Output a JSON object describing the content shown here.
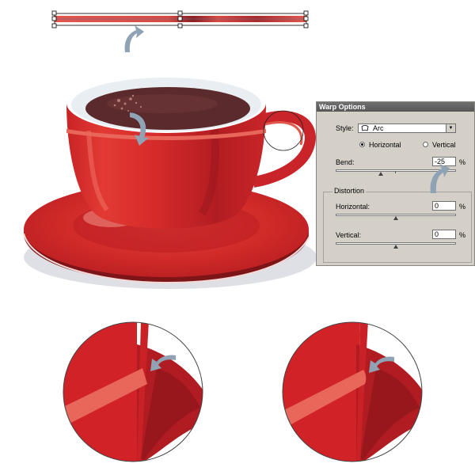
{
  "dialog": {
    "title": "Warp Options",
    "style_label": "Style:",
    "style_value": "Arc",
    "orientation": {
      "horizontal_label": "Horizontal",
      "vertical_label": "Vertical",
      "selected": "horizontal"
    },
    "bend_label": "Bend:",
    "bend_value": "-25",
    "bend_unit": "%",
    "bend_level": 0.375,
    "distortion_label": "Distortion",
    "horizontal_label": "Horizontal:",
    "horizontal_value": "0",
    "horizontal_unit": "%",
    "horizontal_level": 0.5,
    "vertical_label": "Vertical:",
    "vertical_value": "0",
    "vertical_unit": "%",
    "vertical_level": 0.5
  },
  "icons": {
    "cursor_arrows": [
      "top-arrow-icon",
      "cup-arrow-icon",
      "bend-arrow-icon",
      "zoom-left-arrow-icon",
      "zoom-right-arrow-icon"
    ]
  },
  "colors": {
    "cup_red": "#d42727",
    "cup_dark": "#9e1a1f",
    "stripe": "#e8675a",
    "coffee": "#5a2a2c",
    "arrow": "#8fa3b5",
    "dialog_bg": "#d4d0c8"
  }
}
